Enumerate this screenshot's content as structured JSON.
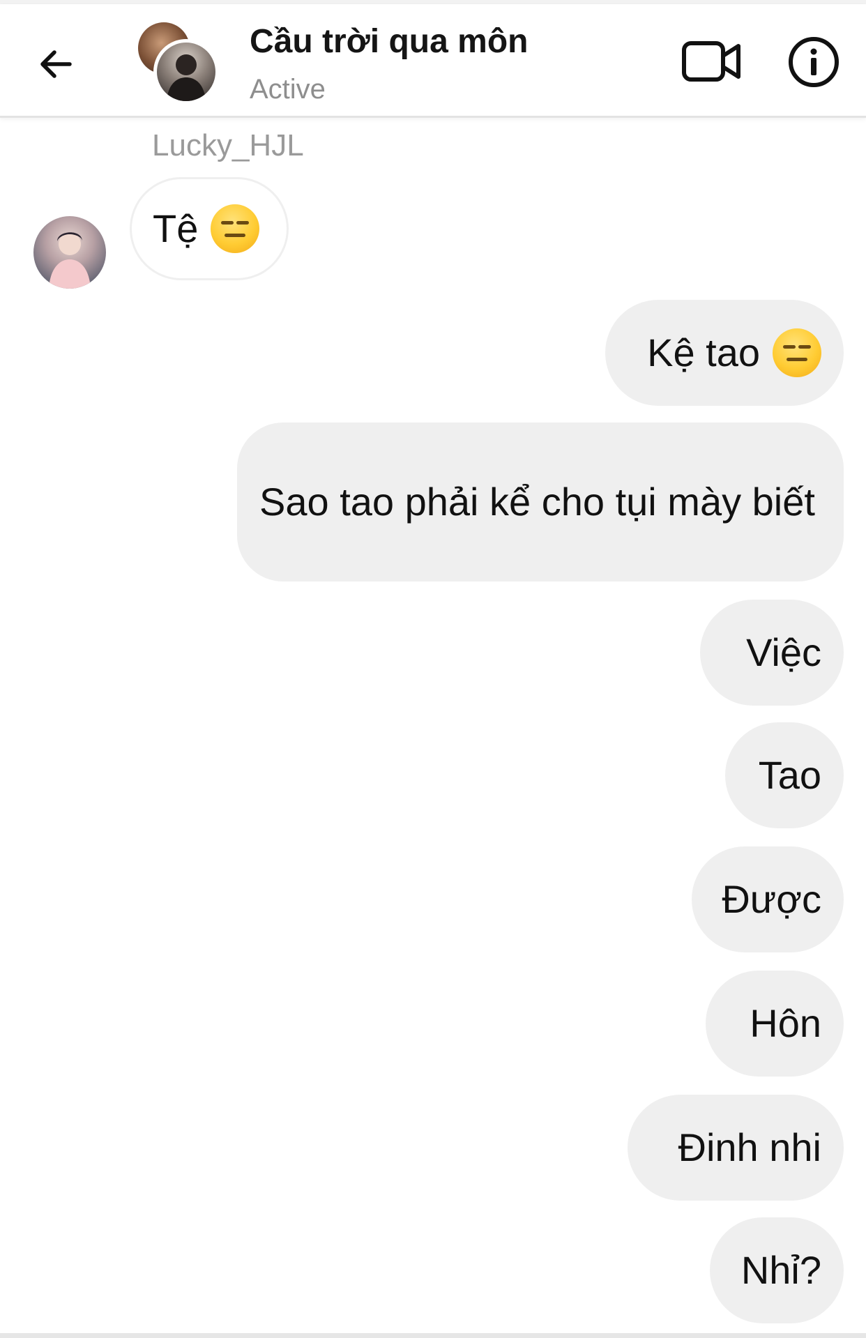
{
  "header": {
    "title": "Cầu trời qua môn",
    "status": "Active"
  },
  "icons": {
    "back": "arrow-left-icon",
    "video": "video-camera-icon",
    "info": "info-icon",
    "emoji": "expressionless-face-emoji"
  },
  "thread": {
    "sender_name": "Lucky_HJL",
    "incoming": [
      {
        "text": "Tệ",
        "emoji": "😑"
      }
    ],
    "outgoing": [
      {
        "text": "Kệ tao",
        "emoji": "😑"
      },
      {
        "text": "Sao tao phải kể cho tụi mày biết"
      },
      {
        "text": "Việc"
      },
      {
        "text": "Tao"
      },
      {
        "text": "Được"
      },
      {
        "text": "Hôn"
      },
      {
        "text": "Đinh nhi"
      },
      {
        "text": "Nhỉ?"
      }
    ]
  },
  "colors": {
    "outgoing_bubble": "#efefef",
    "incoming_bubble": "#ffffff",
    "secondary_text": "#8e8e8e"
  }
}
